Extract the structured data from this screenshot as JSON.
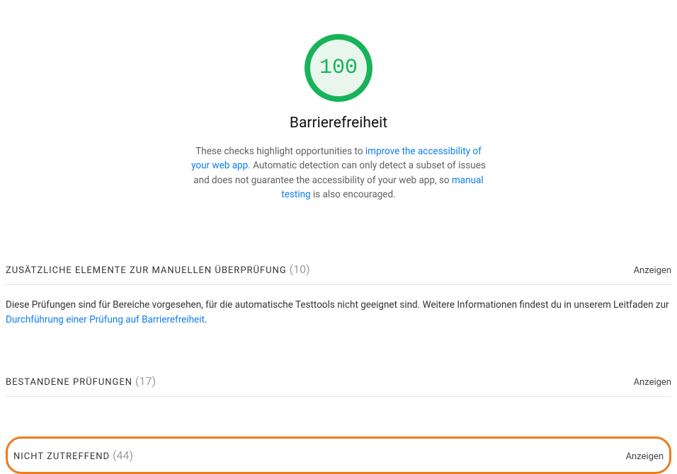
{
  "score": {
    "value": "100",
    "title": "Barrierefreiheit",
    "desc_prefix": "These checks highlight opportunities to ",
    "desc_link1": "improve the accessibility of your web app",
    "desc_mid": ". Automatic detection can only detect a subset of issues and does not guarantee the accessibility of your web app, so ",
    "desc_link2": "manual testing",
    "desc_suffix": " is also encouraged."
  },
  "sections": {
    "manual": {
      "title": "ZUSÄTZLICHE ELEMENTE ZUR MANUELLEN ÜBERPRÜFUNG",
      "count": "(10)",
      "toggle": "Anzeigen",
      "body_prefix": "Diese Prüfungen sind für Bereiche vorgesehen, für die automatische Testtools nicht geeignet sind. Weitere Informationen findest du in unserem Leitfaden zur ",
      "body_link": "Durchführung einer Prüfung auf Barrierefreiheit",
      "body_suffix": "."
    },
    "passed": {
      "title": "BESTANDENE PRÜFUNGEN",
      "count": "(17)",
      "toggle": "Anzeigen"
    },
    "na": {
      "title": "NICHT ZUTREFFEND",
      "count": "(44)",
      "toggle": "Anzeigen"
    }
  }
}
